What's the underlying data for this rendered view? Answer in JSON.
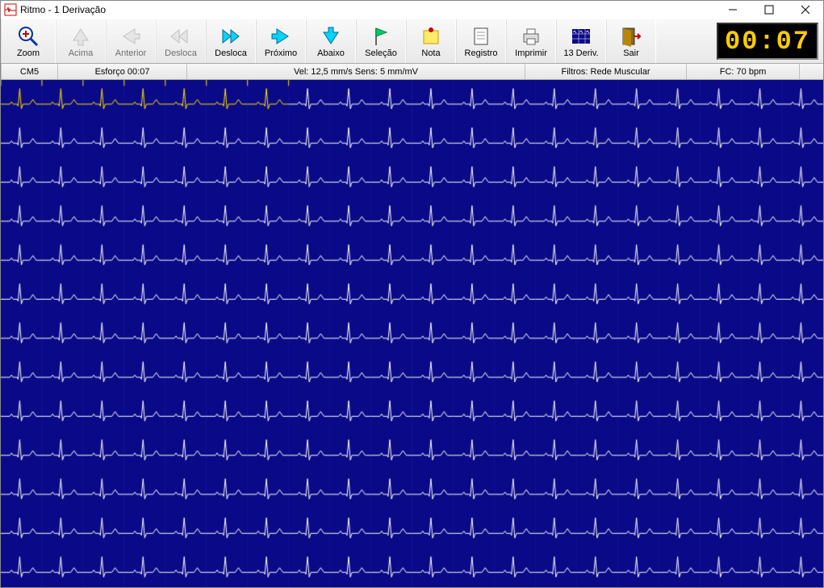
{
  "titlebar": {
    "title": "Ritmo - 1 Derivação"
  },
  "toolbar": {
    "zoom": {
      "label": "Zoom"
    },
    "acima": {
      "label": "Acima"
    },
    "anterior": {
      "label": "Anterior"
    },
    "desloca_l": {
      "label": "Desloca"
    },
    "desloca_r": {
      "label": "Desloca"
    },
    "proximo": {
      "label": "Próximo"
    },
    "abaixo": {
      "label": "Abaixo"
    },
    "selecao": {
      "label": "Seleção"
    },
    "nota": {
      "label": "Nota"
    },
    "registro": {
      "label": "Registro"
    },
    "imprimir": {
      "label": "Imprimir"
    },
    "deriv13": {
      "label": "13 Deriv."
    },
    "sair": {
      "label": "Sair"
    }
  },
  "timer": {
    "value": "00:07"
  },
  "status": {
    "lead": "CM5",
    "esforco": "Esforço 00:07",
    "vel": "Vel: 12,5 mm/s Sens: 5 mm/mV",
    "filtros": "Filtros: Rede Muscular",
    "fc": "FC: 70 bpm"
  },
  "ecg": {
    "rows": 13,
    "beats_per_row": 20,
    "highlight_row": 0,
    "highlight_beats": 7,
    "colors": {
      "background": "#0a0a88",
      "trace": "#ffffff",
      "highlight": "#ffe000",
      "grid": "#1a1aa8"
    }
  }
}
